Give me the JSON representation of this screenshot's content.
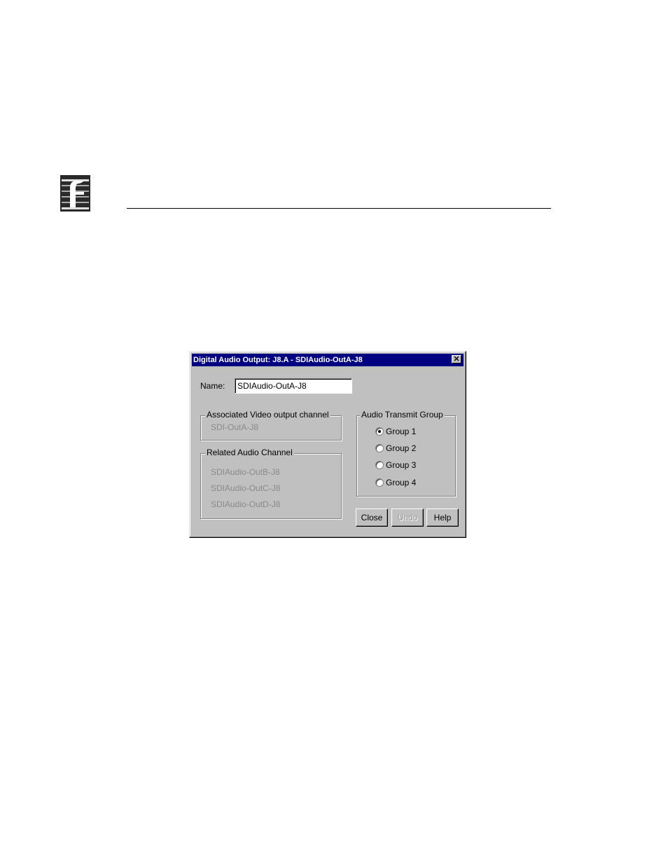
{
  "dialog": {
    "title": "Digital Audio Output: J8.A - SDIAudio-OutA-J8",
    "close_glyph": "✕",
    "name_label": "Name:",
    "name_value": "SDIAudio-OutA-J8",
    "assoc_group_label": "Associated Video output channel",
    "assoc_value": "SDI-OutA-J8",
    "related_group_label": "Related Audio Channel",
    "related_items": [
      "SDIAudio-OutB-J8",
      "SDIAudio-OutC-J8",
      "SDIAudio-OutD-J8"
    ],
    "transmit_group_label": "Audio Transmit Group",
    "transmit_options": [
      "Group 1",
      "Group 2",
      "Group 3",
      "Group 4"
    ],
    "transmit_selected": "Group 1",
    "buttons": {
      "close": "Close",
      "undo": "Undo",
      "help": "Help"
    }
  },
  "colors": {
    "titlebar": "#000080",
    "dialog_bg": "#c0c0c0",
    "disabled_text": "#8a8a8a"
  },
  "icons": {
    "logo": "company-logo-icon"
  }
}
